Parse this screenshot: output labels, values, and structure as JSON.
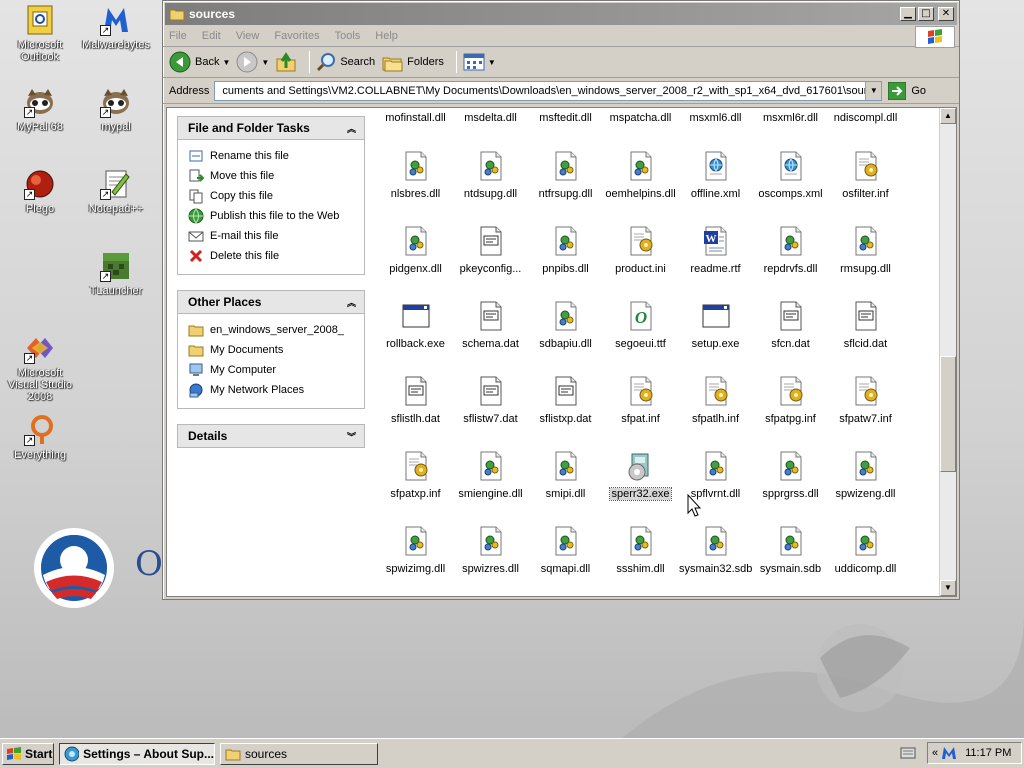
{
  "desktop": {
    "icons": [
      {
        "label": "Microsoft Outlook",
        "icon": "outlook-icon"
      },
      {
        "label": "Malwarebytes",
        "icon": "malwarebytes-icon"
      },
      {
        "label": "MyPal 68",
        "icon": "mypal-icon"
      },
      {
        "label": "mypal",
        "icon": "mypal-icon"
      },
      {
        "label": "Plego",
        "icon": "plego-icon"
      },
      {
        "label": "Notepad++",
        "icon": "notepadpp-icon"
      },
      {
        "label": "TLauncher",
        "icon": "tlauncher-icon"
      },
      {
        "label": "Microsoft Visual Studio 2008",
        "icon": "visual-studio-icon"
      },
      {
        "label": "Everything",
        "icon": "everything-icon"
      }
    ],
    "wallpaper_letter": "O"
  },
  "window": {
    "title": "sources",
    "menu": [
      "File",
      "Edit",
      "View",
      "Favorites",
      "Tools",
      "Help"
    ],
    "toolbar": {
      "back": "Back",
      "search": "Search",
      "folders": "Folders"
    },
    "address": {
      "label": "Address",
      "value": "cuments and Settings\\VM2.COLLABNET\\My Documents\\Downloads\\en_windows_server_2008_r2_with_sp1_x64_dvd_617601\\sources",
      "go": "Go"
    }
  },
  "taskpane": {
    "file_tasks": {
      "title": "File and Folder Tasks",
      "items": [
        {
          "label": "Rename this file",
          "icon": "rename-icon"
        },
        {
          "label": "Move this file",
          "icon": "move-icon"
        },
        {
          "label": "Copy this file",
          "icon": "copy-icon"
        },
        {
          "label": "Publish this file to the Web",
          "icon": "globe-icon"
        },
        {
          "label": "E-mail this file",
          "icon": "email-icon"
        },
        {
          "label": "Delete this file",
          "icon": "delete-icon"
        }
      ]
    },
    "other_places": {
      "title": "Other Places",
      "items": [
        {
          "label": "en_windows_server_2008_",
          "icon": "folder-icon"
        },
        {
          "label": "My Documents",
          "icon": "folder-icon"
        },
        {
          "label": "My Computer",
          "icon": "computer-icon"
        },
        {
          "label": "My Network Places",
          "icon": "network-icon"
        }
      ]
    },
    "details": {
      "title": "Details"
    }
  },
  "files": {
    "top_row": [
      "mofinstall.dll",
      "msdelta.dll",
      "msftedit.dll",
      "mspatcha.dll",
      "msxml6.dll",
      "msxml6r.dll",
      "ndiscompl.dll"
    ],
    "rows": [
      [
        {
          "name": "nlsbres.dll",
          "icon": "dll"
        },
        {
          "name": "ntdsupg.dll",
          "icon": "dll"
        },
        {
          "name": "ntfrsupg.dll",
          "icon": "dll"
        },
        {
          "name": "oemhelpins.dll",
          "icon": "dll"
        },
        {
          "name": "offline.xml",
          "icon": "xml"
        },
        {
          "name": "oscomps.xml",
          "icon": "xml"
        },
        {
          "name": "osfilter.inf",
          "icon": "inf"
        }
      ],
      [
        {
          "name": "pidgenx.dll",
          "icon": "dll"
        },
        {
          "name": "pkeyconfig...",
          "icon": "dat"
        },
        {
          "name": "pnpibs.dll",
          "icon": "dll"
        },
        {
          "name": "product.ini",
          "icon": "inf"
        },
        {
          "name": "readme.rtf",
          "icon": "rtf"
        },
        {
          "name": "repdrvfs.dll",
          "icon": "dll"
        },
        {
          "name": "rmsupg.dll",
          "icon": "dll"
        }
      ],
      [
        {
          "name": "rollback.exe",
          "icon": "exe"
        },
        {
          "name": "schema.dat",
          "icon": "dat"
        },
        {
          "name": "sdbapiu.dll",
          "icon": "dll"
        },
        {
          "name": "segoeui.ttf",
          "icon": "ttf"
        },
        {
          "name": "setup.exe",
          "icon": "exe"
        },
        {
          "name": "sfcn.dat",
          "icon": "dat"
        },
        {
          "name": "sflcid.dat",
          "icon": "dat"
        }
      ],
      [
        {
          "name": "sflistlh.dat",
          "icon": "dat"
        },
        {
          "name": "sflistw7.dat",
          "icon": "dat"
        },
        {
          "name": "sflistxp.dat",
          "icon": "dat"
        },
        {
          "name": "sfpat.inf",
          "icon": "inf"
        },
        {
          "name": "sfpatlh.inf",
          "icon": "inf"
        },
        {
          "name": "sfpatpg.inf",
          "icon": "inf"
        },
        {
          "name": "sfpatw7.inf",
          "icon": "inf"
        }
      ],
      [
        {
          "name": "sfpatxp.inf",
          "icon": "inf"
        },
        {
          "name": "smiengine.dll",
          "icon": "dll"
        },
        {
          "name": "smipi.dll",
          "icon": "dll"
        },
        {
          "name": "sperr32.exe",
          "icon": "sperr",
          "selected": true
        },
        {
          "name": "spflvrnt.dll",
          "icon": "dll"
        },
        {
          "name": "spprgrss.dll",
          "icon": "dll"
        },
        {
          "name": "spwizeng.dll",
          "icon": "dll"
        }
      ],
      [
        {
          "name": "spwizimg.dll",
          "icon": "dll"
        },
        {
          "name": "spwizres.dll",
          "icon": "dll"
        },
        {
          "name": "sqmapi.dll",
          "icon": "dll"
        },
        {
          "name": "ssshim.dll",
          "icon": "dll"
        },
        {
          "name": "sysmain32.sdb",
          "icon": "dll"
        },
        {
          "name": "sysmain.sdb",
          "icon": "dll"
        },
        {
          "name": "uddicomp.dll",
          "icon": "dll"
        }
      ]
    ]
  },
  "taskbar": {
    "start": "Start",
    "tasks": [
      {
        "label": "Settings – About Sup...",
        "active": true
      },
      {
        "label": "sources",
        "active": false
      }
    ],
    "tray_chevron": "«",
    "clock": "11:17 PM"
  },
  "colors": {
    "accent": "#316ac5",
    "titlebar": "#8a8a8a",
    "panel_head": "#e6e6e6"
  }
}
